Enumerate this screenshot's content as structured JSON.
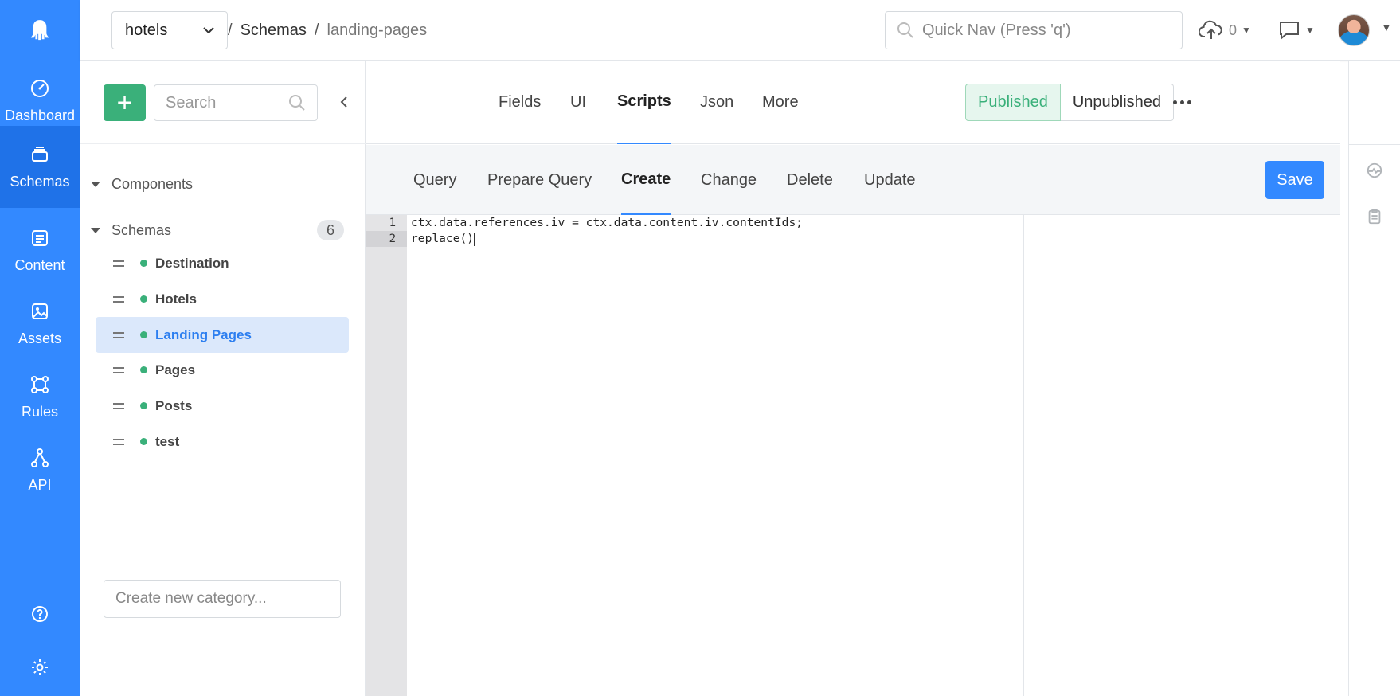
{
  "rail": {
    "items": [
      {
        "label": "Dashboard",
        "icon": "dashboard-icon",
        "active": false
      },
      {
        "label": "Schemas",
        "icon": "schemas-icon",
        "active": true
      },
      {
        "label": "Content",
        "icon": "content-icon",
        "active": false
      },
      {
        "label": "Assets",
        "icon": "assets-icon",
        "active": false
      },
      {
        "label": "Rules",
        "icon": "rules-icon",
        "active": false
      },
      {
        "label": "API",
        "icon": "api-icon",
        "active": false
      }
    ]
  },
  "topbar": {
    "app_name": "hotels",
    "breadcrumb_sep": "/",
    "breadcrumb_link": "Schemas",
    "breadcrumb_current": "landing-pages",
    "quicknav_placeholder": "Quick Nav (Press 'q')",
    "upload_count": "0"
  },
  "sidebar": {
    "search_placeholder": "Search",
    "components_label": "Components",
    "schemas_label": "Schemas",
    "schemas_count": "6",
    "schemas": [
      {
        "name": "Destination",
        "active": false
      },
      {
        "name": "Hotels",
        "active": false
      },
      {
        "name": "Landing Pages",
        "active": true
      },
      {
        "name": "Pages",
        "active": false
      },
      {
        "name": "Posts",
        "active": false
      },
      {
        "name": "test",
        "active": false
      }
    ],
    "new_category_placeholder": "Create new category..."
  },
  "schema_tabs": [
    "Fields",
    "UI",
    "Scripts",
    "Json",
    "More"
  ],
  "active_schema_tab": "Scripts",
  "publish": {
    "published": "Published",
    "unpublished": "Unpublished"
  },
  "script_tabs": [
    "Query",
    "Prepare Query",
    "Create",
    "Change",
    "Delete",
    "Update"
  ],
  "active_script_tab": "Create",
  "save_label": "Save",
  "editor": {
    "lines": [
      "ctx.data.references.iv = ctx.data.content.iv.contentIds;",
      "replace()"
    ],
    "current_line": 2
  },
  "colors": {
    "brand": "#3389ff",
    "success": "#3ab07a"
  }
}
